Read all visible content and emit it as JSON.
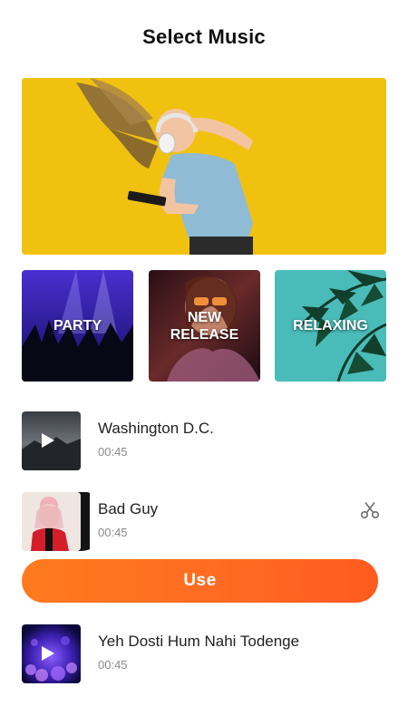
{
  "header": {
    "title": "Select Music"
  },
  "categories": [
    {
      "label": "PARTY"
    },
    {
      "label": "NEW\nRELEASE"
    },
    {
      "label": "RELAXING"
    }
  ],
  "tracks": [
    {
      "title": "Washington D.C.",
      "duration": "00:45"
    },
    {
      "title": "Bad Guy",
      "duration": "00:45",
      "selected": true
    },
    {
      "title": "Yeh Dosti Hum Nahi Todenge",
      "duration": "00:45"
    }
  ],
  "actions": {
    "use_label": "Use"
  },
  "colors": {
    "accent": "#ff6a22",
    "banner": "#f1c40f",
    "text": "#1e1e1e",
    "secondary": "#8a8a8a"
  },
  "icons": {
    "cut": "scissors-icon",
    "play": "play-icon"
  }
}
